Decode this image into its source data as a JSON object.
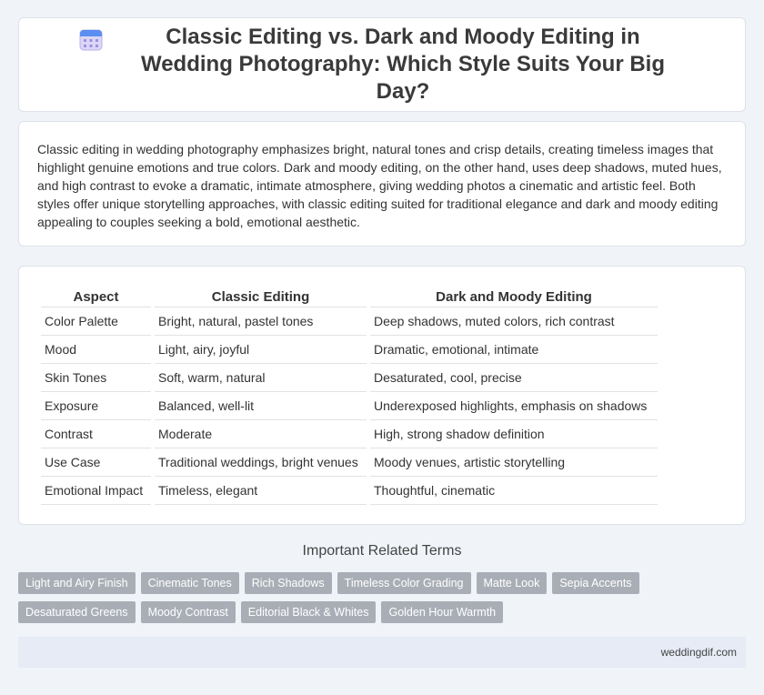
{
  "header": {
    "title": "Classic Editing vs. Dark and Moody Editing in Wedding Photography: Which Style Suits Your Big Day?",
    "icon": "calendar-icon"
  },
  "intro": {
    "text": "Classic editing in wedding photography emphasizes bright, natural tones and crisp details, creating timeless images that highlight genuine emotions and true colors. Dark and moody editing, on the other hand, uses deep shadows, muted hues, and high contrast to evoke a dramatic, intimate atmosphere, giving wedding photos a cinematic and artistic feel. Both styles offer unique storytelling approaches, with classic editing suited for traditional elegance and dark and moody editing appealing to couples seeking a bold, emotional aesthetic."
  },
  "table": {
    "headers": [
      "Aspect",
      "Classic Editing",
      "Dark and Moody Editing"
    ],
    "rows": [
      [
        "Color Palette",
        "Bright, natural, pastel tones",
        "Deep shadows, muted colors, rich contrast"
      ],
      [
        "Mood",
        "Light, airy, joyful",
        "Dramatic, emotional, intimate"
      ],
      [
        "Skin Tones",
        "Soft, warm, natural",
        "Desaturated, cool, precise"
      ],
      [
        "Exposure",
        "Balanced, well-lit",
        "Underexposed highlights, emphasis on shadows"
      ],
      [
        "Contrast",
        "Moderate",
        "High, strong shadow definition"
      ],
      [
        "Use Case",
        "Traditional weddings, bright venues",
        "Moody venues, artistic storytelling"
      ],
      [
        "Emotional Impact",
        "Timeless, elegant",
        "Thoughtful, cinematic"
      ]
    ]
  },
  "related": {
    "title": "Important Related Terms",
    "tags": [
      "Light and Airy Finish",
      "Cinematic Tones",
      "Rich Shadows",
      "Timeless Color Grading",
      "Matte Look",
      "Sepia Accents",
      "Desaturated Greens",
      "Moody Contrast",
      "Editorial Black & Whites",
      "Golden Hour Warmth"
    ]
  },
  "footer": {
    "site": "weddingdif.com"
  }
}
